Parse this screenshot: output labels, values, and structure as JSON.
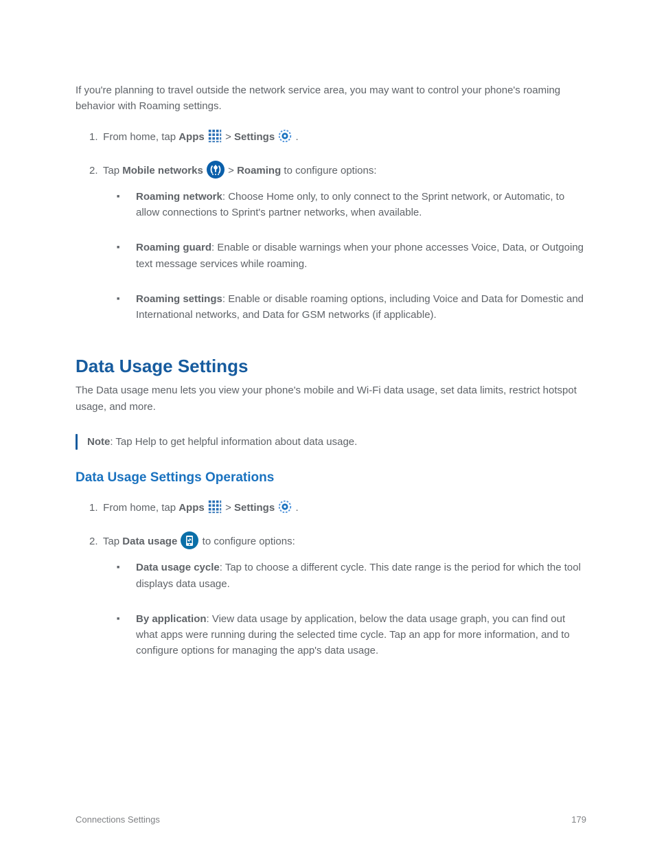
{
  "roaming": {
    "intro_a": "If you're planning to travel outside ",
    "intro_b": "the network service area",
    "intro_c": ", you may want to control your phone's roaming behavior with Roaming setting",
    "intro_d": "s.",
    "step1_a": "From home, tap ",
    "step1_b": "Apps",
    "step1_c": " > ",
    "step1_d": "Settings",
    "step1_e": ".",
    "step2_a": "Tap ",
    "step2_b": "Mobile networks",
    "step2_c": " > ",
    "step2_d": "Roaming",
    "step2_e": " to configure options:",
    "bullets": [
      {
        "b": "Roaming network",
        "rest": ": Choose Home only, to only connect to the Sprint network, or Automatic, to allow connections to Sprint's partner networks, when available."
      },
      {
        "b": "Roaming guard",
        "rest": ": Enable or disable warnings when your phone accesses Voice, Data, or Outgoing text message services while roaming."
      },
      {
        "b": "Roaming settings",
        "rest": ": Enable or disable roaming options, including Voice and Data for Domestic and International networks, and Data for GSM networks (if applicable)."
      }
    ]
  },
  "data_usage": {
    "title": "Data Usage Settings",
    "desc": "The Data usage menu lets you view your phone's mobile and Wi-Fi data usage, set data limits, restrict hotspot usage, and more.",
    "note_label": "Note",
    "note_text": ": Tap Help to get helpful information about data usage.",
    "sub_title": "Data Usage Settings Operations",
    "step1_a": "From home, tap ",
    "step1_b": "Apps",
    "step1_c": " > ",
    "step1_d": "Settings",
    "step1_e": ".",
    "step2_a": "Tap ",
    "step2_b": "Data usage",
    "step2_c": " to configure options:",
    "bullets": [
      {
        "b": "Data usage cycle",
        "rest": ": Tap to choose a different cycle. This date range is the period for which the tool displays data usage."
      },
      {
        "b": "By application",
        "rest_a": ": View data usage by application, below the data usage graph, you can find out what apps were ",
        "rest_b": "running ",
        "rest_c": "during the selected time cycle. Tap an app for more information, and to configure options for managing the app's data usage."
      }
    ]
  },
  "footer": {
    "left": "Connections Settings",
    "right": "179"
  },
  "inline_labels": {
    "num1": "1. ",
    "num2": "2. "
  }
}
